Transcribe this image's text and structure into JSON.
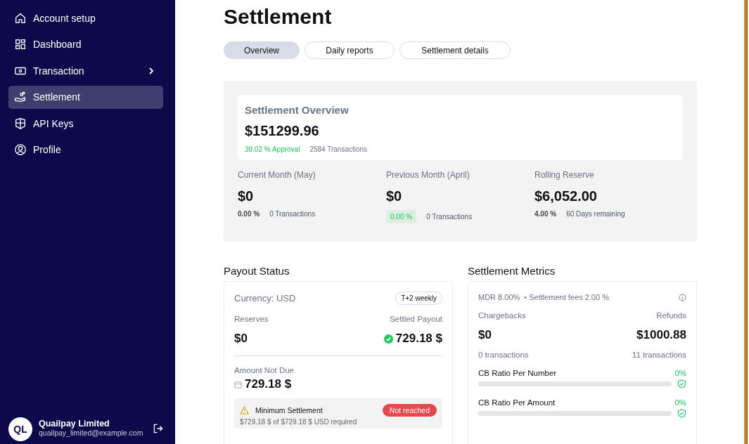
{
  "sidebar": {
    "items": [
      {
        "label": "Account setup",
        "selected": false,
        "has_submenu": false
      },
      {
        "label": "Dashboard",
        "selected": false,
        "has_submenu": false
      },
      {
        "label": "Transaction",
        "selected": false,
        "has_submenu": true
      },
      {
        "label": "Settlement",
        "selected": true,
        "has_submenu": false
      },
      {
        "label": "API Keys",
        "selected": false,
        "has_submenu": false
      },
      {
        "label": "Profile",
        "selected": false,
        "has_submenu": false
      }
    ],
    "user": {
      "initials": "QL",
      "name": "Quailpay Limited",
      "email": "quailpay_limited@example.com"
    }
  },
  "title": "Settlement",
  "tabs": [
    {
      "label": "Overview",
      "selected": true
    },
    {
      "label": "Daily reports",
      "selected": false
    },
    {
      "label": "Settlement details",
      "selected": false
    }
  ],
  "overview": {
    "title": "Settlement Overview",
    "amount": "$151299.96",
    "approval": "38.02 % Approval",
    "transactions": "2584 Transactions",
    "stats": [
      {
        "label": "Current Month (May)",
        "amount": "$0",
        "percent": "0.00 %",
        "highlight": false,
        "note": "0 Transactions"
      },
      {
        "label": "Previous Month (April)",
        "amount": "$0",
        "percent": "0.00 %",
        "highlight": true,
        "note": "0 Transactions"
      },
      {
        "label": "Rolling Reserve",
        "amount": "$6,052.00",
        "percent": "4.00 %",
        "highlight": false,
        "note": "60 Days remaining"
      }
    ]
  },
  "payout": {
    "heading": "Payout Status",
    "currency": "Currency: USD",
    "schedule": "T+2 weekly",
    "reserves_label": "Reserves",
    "settled_label": "Settled Payout",
    "reserves": "$0",
    "settled": "729.18 $",
    "not_due_label": "Amount Not Due",
    "not_due": "729.18 $",
    "minimum": {
      "title": "Minimum Settlement",
      "status": "Not reached",
      "detail": "$729.18 $ of $729.18 $ USD required"
    }
  },
  "metrics": {
    "heading": "Settlement Metrics",
    "mdr": "MDR 8.00%",
    "fees": "• Settlement fees 2.00 %",
    "chargebacks_label": "Chargebacks",
    "refunds_label": "Refunds",
    "chargebacks": "$0",
    "refunds": "$1000.88",
    "chargebacks_count": "0 transactions",
    "refunds_count": "11 transactions",
    "ratios": [
      {
        "label": "CB Ratio Per Number",
        "value": "0%",
        "level": 0
      },
      {
        "label": "CB Ratio Per Amount",
        "value": "0%",
        "level": 0
      }
    ]
  }
}
